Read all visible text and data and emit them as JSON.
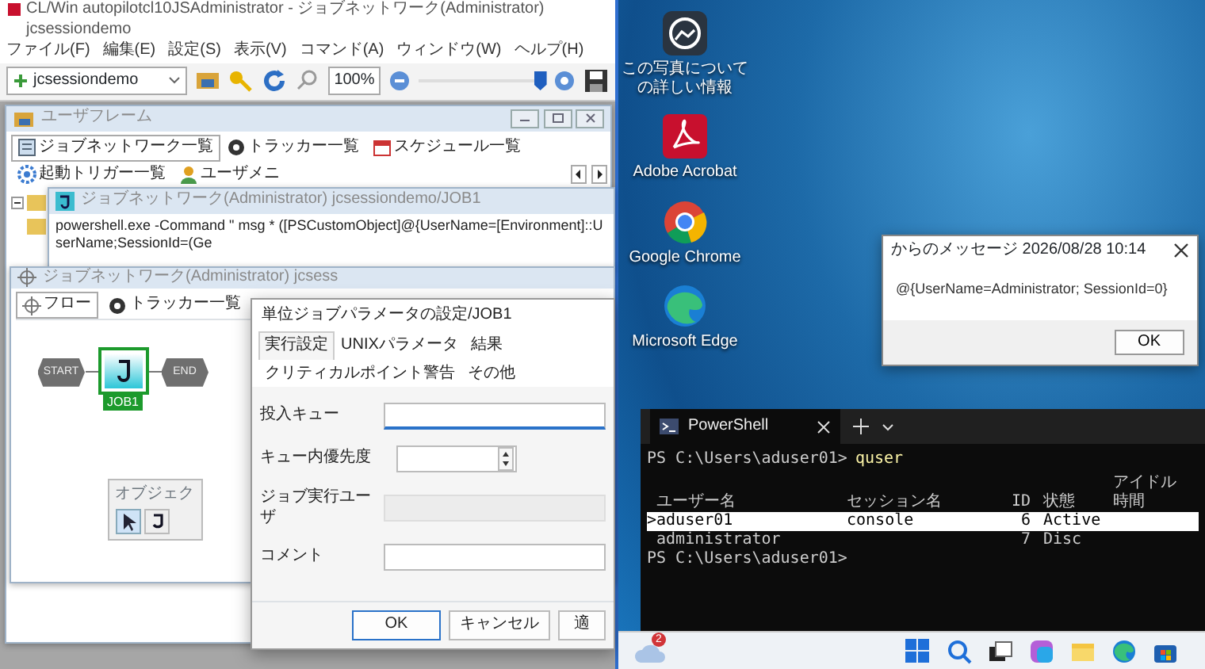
{
  "app": {
    "title": "CL/Win autopilotcl10JSAdministrator - ジョブネットワーク(Administrator) jcsessiondemo",
    "menu": [
      "ファイル(F)",
      "編集(E)",
      "設定(S)",
      "表示(V)",
      "コマンド(A)",
      "ウィンドウ(W)",
      "ヘルプ(H)"
    ],
    "toolbar": {
      "combo": "jcsessiondemo",
      "zoom": "100%",
      "zoom_slider": {
        "level": 0.93
      }
    },
    "user_frame": {
      "title": "ユーザフレーム",
      "tabs": [
        {
          "kind": "list",
          "label": "ジョブネットワーク一覧",
          "selected": true
        },
        {
          "kind": "tracker",
          "label": "トラッカー一覧",
          "selected": false
        },
        {
          "kind": "calendar",
          "label": "スケジュール一覧",
          "selected": false
        },
        {
          "kind": "gear",
          "label": "起動トリガー一覧",
          "selected": false
        },
        {
          "kind": "person",
          "label": "ユーザメニ",
          "selected": false
        }
      ]
    },
    "job_window": {
      "title": "ジョブネットワーク(Administrator) jcsessiondemo/JOB1",
      "command": "powershell.exe -Command \" msg * ([PSCustomObject]@{UserName=[Environment]::UserName;SessionId=(Ge"
    },
    "flow_window": {
      "title": "ジョブネットワーク(Administrator) jcsess",
      "tabs": [
        {
          "kind": "flow",
          "label": "フロー",
          "selected": true
        },
        {
          "kind": "tracker",
          "label": "トラッカー一覧",
          "selected": false
        }
      ],
      "nodes": [
        {
          "kind": "start",
          "label": "START",
          "selected": false
        },
        {
          "kind": "job",
          "label": "JOB1",
          "selected": true
        },
        {
          "kind": "end",
          "label": "END",
          "selected": false
        }
      ],
      "palette": {
        "title": "オブジェク"
      }
    },
    "dialog": {
      "title": "単位ジョブパラメータの設定/JOB1",
      "tabs": [
        {
          "label": "実行設定",
          "selected": true
        },
        {
          "label": "UNIXパラメータ",
          "selected": false
        },
        {
          "label": "結果",
          "selected": false
        },
        {
          "label": "クリティカルポイント警告",
          "selected": false
        },
        {
          "label": "その他",
          "selected": false
        }
      ],
      "fields": [
        {
          "label": "投入キュー",
          "kind": "text",
          "focused": true,
          "disabled": false
        },
        {
          "label": "キュー内優先度",
          "kind": "spinner",
          "focused": false,
          "disabled": false
        },
        {
          "label": "ジョブ実行ユーザ",
          "kind": "text",
          "focused": false,
          "disabled": true
        },
        {
          "label": "コメント",
          "kind": "text",
          "focused": false,
          "disabled": false
        }
      ],
      "buttons": [
        {
          "label": "OK",
          "default": true
        },
        {
          "label": "キャンセル",
          "default": false
        },
        {
          "label": "適",
          "default": false
        }
      ]
    }
  },
  "desktop": {
    "icons": [
      {
        "kind": "photo-info",
        "label": "この写真についての詳しい情報"
      },
      {
        "kind": "pdf",
        "label": "Adobe Acrobat"
      },
      {
        "kind": "chrome",
        "label": "Google Chrome"
      },
      {
        "kind": "edge",
        "label": "Microsoft Edge"
      }
    ],
    "message_box": {
      "title": "からのメッセージ 2026/08/28 10:14",
      "text": "@{UserName=Administrator; SessionId=0}",
      "button": "OK"
    },
    "terminal": {
      "tab": "PowerShell",
      "prompt": "PS C:\\Users\\aduser01>",
      "command": "quser",
      "columns": [
        "ユーザー名",
        "セッション名",
        "ID",
        "状態",
        "アイドル時間"
      ],
      "rows": [
        {
          "cells": [
            ">aduser01",
            "console",
            "6",
            "Active"
          ],
          "selected": true
        },
        {
          "cells": [
            " administrator",
            "",
            "7",
            "Disc"
          ],
          "selected": false
        }
      ],
      "final_prompt": "PS C:\\Users\\aduser01>"
    },
    "taskbar": {
      "badge": "2"
    }
  }
}
